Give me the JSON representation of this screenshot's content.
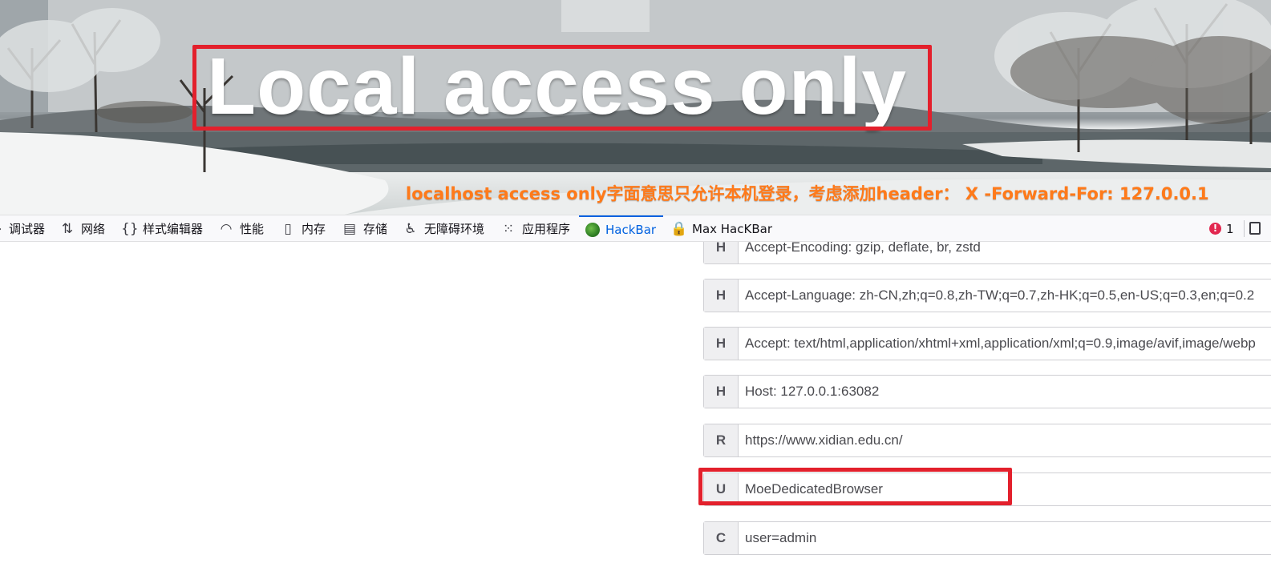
{
  "hero": {
    "title": "Local access only",
    "note": "localhost access only字面意思只允许本机登录，考虑添加header： X -Forward-For: 127.0.0.1"
  },
  "devtools": {
    "tabs": [
      {
        "label": "调试器",
        "icon": "debugger-icon"
      },
      {
        "label": "网络",
        "icon": "network-arrows-icon"
      },
      {
        "label": "样式编辑器",
        "icon": "braces-icon"
      },
      {
        "label": "性能",
        "icon": "gauge-icon"
      },
      {
        "label": "内存",
        "icon": "memory-chip-icon"
      },
      {
        "label": "存储",
        "icon": "storage-icon"
      },
      {
        "label": "无障碍环境",
        "icon": "accessibility-icon"
      },
      {
        "label": "应用程序",
        "icon": "app-grid-icon"
      },
      {
        "label": "HackBar",
        "icon": "hackbar-logo-icon",
        "active": true
      },
      {
        "label": "Max HacKBar",
        "icon": "lock-icon"
      }
    ],
    "error_count": "1"
  },
  "headers": [
    {
      "key": "H",
      "value": "Accept-Encoding: gzip, deflate, br, zstd"
    },
    {
      "key": "H",
      "value": "Accept-Language: zh-CN,zh;q=0.8,zh-TW;q=0.7,zh-HK;q=0.5,en-US;q=0.3,en;q=0.2"
    },
    {
      "key": "H",
      "value": "Accept: text/html,application/xhtml+xml,application/xml;q=0.9,image/avif,image/webp"
    },
    {
      "key": "H",
      "value": "Host: 127.0.0.1:63082"
    },
    {
      "key": "R",
      "value": "https://www.xidian.edu.cn/"
    },
    {
      "key": "U",
      "value": "MoeDedicatedBrowser"
    },
    {
      "key": "C",
      "value": "user=admin"
    }
  ],
  "colors": {
    "highlight": "#e3202c",
    "note": "#ff7a1a",
    "active_tab": "#0061e0"
  }
}
